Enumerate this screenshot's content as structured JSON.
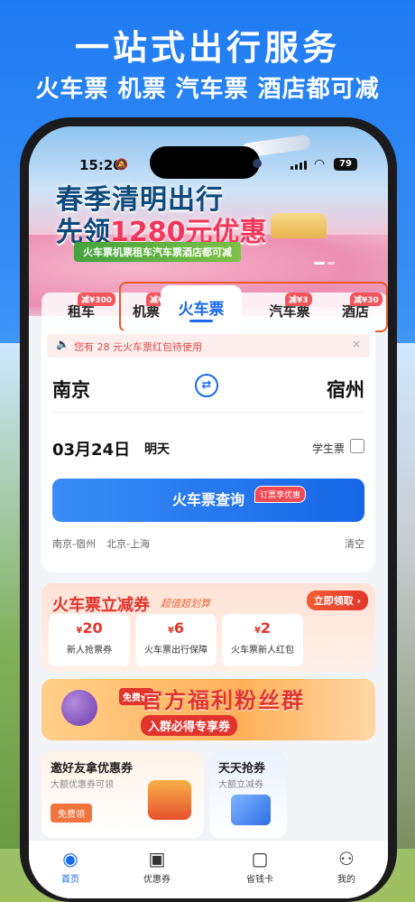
{
  "promo": {
    "title": "一站式出行服务",
    "subtitle": "火车票 机票 汽车票 酒店都可减"
  },
  "status_bar": {
    "time": "15:20",
    "battery": "79"
  },
  "banner": {
    "title_line1": "春季清明出行",
    "title_line2_prefix": "先领",
    "title_line2_highlight": "1280元优惠",
    "ribbon": "火车票机票租车汽车票酒店都可减"
  },
  "tabs": [
    {
      "label": "租车",
      "badge": "减¥300"
    },
    {
      "label": "机票",
      "badge": "减¥20"
    },
    {
      "label": "火车票",
      "badge": "",
      "active": true
    },
    {
      "label": "汽车票",
      "badge": "减¥3"
    },
    {
      "label": "酒店",
      "badge": "减¥30"
    }
  ],
  "notice": {
    "text": "您有 28 元火车票红包待使用",
    "close": "×"
  },
  "search": {
    "from": "南京",
    "to": "宿州",
    "date": "03月24日",
    "weekday": "明天",
    "student_label": "学生票",
    "button_label": "火车票查询",
    "button_badge": "订票享优惠",
    "history": [
      "南京-宿州",
      "北京-上海"
    ],
    "clear_label": "清空"
  },
  "coupons": {
    "title": "火车票立减券",
    "subtitle": "超值超划算",
    "cta": "立即领取 ›",
    "items": [
      {
        "currency": "¥",
        "amount": "20",
        "label": "新人抢票券"
      },
      {
        "currency": "¥",
        "amount": "6",
        "label": "火车票出行保障"
      },
      {
        "currency": "¥",
        "amount": "2",
        "label": "火车票新人红包"
      }
    ]
  },
  "fans_banner": {
    "badge": "免费领",
    "title": "官方福利粉丝群",
    "subtitle": "入群必得专享券"
  },
  "mini_cards": [
    {
      "title": "邀好友拿优惠券",
      "subtitle": "大额优惠券可领",
      "button": "免费领"
    },
    {
      "title": "天天抢券",
      "subtitle": "大额立减券"
    }
  ],
  "tabbar": [
    {
      "label": "首页",
      "icon": "home-icon",
      "active": true
    },
    {
      "label": "优惠券",
      "icon": "ticket-icon"
    },
    {
      "label": "省钱卡",
      "icon": "card-icon"
    },
    {
      "label": "我的",
      "icon": "user-icon"
    }
  ],
  "colors": {
    "accent": "#1969e8",
    "coupon_red": "#e0342c",
    "tab_highlight": "#e65b2a"
  }
}
